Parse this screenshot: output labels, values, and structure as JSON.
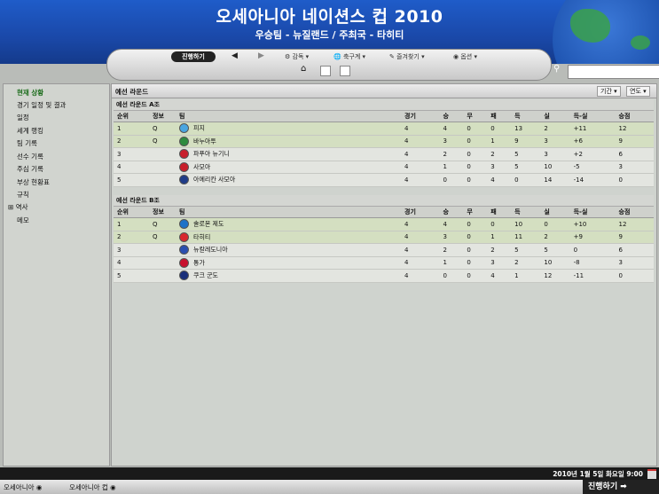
{
  "header": {
    "title": "오세아니아 네이션스 컵 2010",
    "subtitle": "우승팀 - 뉴질랜드 / 주최국 - 타히티"
  },
  "toolbar": {
    "continue": "진행하기",
    "back": "◀",
    "forward": "▶",
    "menus": [
      "감독",
      "축구계",
      "즐겨찾기",
      "옵션"
    ]
  },
  "sidebar": {
    "items": [
      "현재 상황",
      "경기 일정 및 결과",
      "일정",
      "세계 랭킹",
      "팀 기록",
      "선수 기록",
      "주심 기록",
      "부상 현황표",
      "규칙",
      "역사",
      "메모"
    ]
  },
  "main": {
    "title": "예선 라운드",
    "period_label": "기간",
    "year_label": "연도"
  },
  "columns": [
    "순위",
    "정보",
    "팀",
    "경기",
    "승",
    "무",
    "패",
    "득",
    "실",
    "득-실",
    "승점"
  ],
  "groups": [
    {
      "title": "예선 라운드 A조",
      "rows": [
        {
          "pos": "1",
          "info": "Q",
          "team": "피지",
          "p": "4",
          "w": "4",
          "d": "0",
          "l": "0",
          "gf": "13",
          "ga": "2",
          "gd": "+11",
          "pts": "12",
          "flag": "#4aa6e0"
        },
        {
          "pos": "2",
          "info": "Q",
          "team": "바누아투",
          "p": "4",
          "w": "3",
          "d": "0",
          "l": "1",
          "gf": "9",
          "ga": "3",
          "gd": "+6",
          "pts": "9",
          "flag": "#2e8b3e"
        },
        {
          "pos": "3",
          "info": "",
          "team": "파푸아 뉴기니",
          "p": "4",
          "w": "2",
          "d": "0",
          "l": "2",
          "gf": "5",
          "ga": "3",
          "gd": "+2",
          "pts": "6",
          "flag": "#c8202c"
        },
        {
          "pos": "4",
          "info": "",
          "team": "사모아",
          "p": "4",
          "w": "1",
          "d": "0",
          "l": "3",
          "gf": "5",
          "ga": "10",
          "gd": "-5",
          "pts": "3",
          "flag": "#c81e2a"
        },
        {
          "pos": "5",
          "info": "",
          "team": "아메리칸 사모아",
          "p": "4",
          "w": "0",
          "d": "0",
          "l": "4",
          "gf": "0",
          "ga": "14",
          "gd": "-14",
          "pts": "0",
          "flag": "#1f3c88"
        }
      ]
    },
    {
      "title": "예선 라운드 B조",
      "rows": [
        {
          "pos": "1",
          "info": "Q",
          "team": "솔로몬 제도",
          "p": "4",
          "w": "4",
          "d": "0",
          "l": "0",
          "gf": "10",
          "ga": "0",
          "gd": "+10",
          "pts": "12",
          "flag": "#1e73c8"
        },
        {
          "pos": "2",
          "info": "Q",
          "team": "타히티",
          "p": "4",
          "w": "3",
          "d": "0",
          "l": "1",
          "gf": "11",
          "ga": "2",
          "gd": "+9",
          "pts": "9",
          "flag": "#d8282e"
        },
        {
          "pos": "3",
          "info": "",
          "team": "뉴칼레도니아",
          "p": "4",
          "w": "2",
          "d": "0",
          "l": "2",
          "gf": "5",
          "ga": "5",
          "gd": "0",
          "pts": "6",
          "flag": "#2a4fb0"
        },
        {
          "pos": "4",
          "info": "",
          "team": "통가",
          "p": "4",
          "w": "1",
          "d": "0",
          "l": "3",
          "gf": "2",
          "ga": "10",
          "gd": "-8",
          "pts": "3",
          "flag": "#c8102e"
        },
        {
          "pos": "5",
          "info": "",
          "team": "쿠크 군도",
          "p": "4",
          "w": "0",
          "d": "0",
          "l": "4",
          "gf": "1",
          "ga": "12",
          "gd": "-11",
          "pts": "0",
          "flag": "#1a2f7a"
        }
      ]
    }
  ],
  "status": {
    "datetime": "2010년 1월 5일 화요일 9:00"
  },
  "footer": {
    "crumbs": [
      "오세아니아",
      "오세아니아 컵"
    ],
    "continue": "진행하기"
  }
}
